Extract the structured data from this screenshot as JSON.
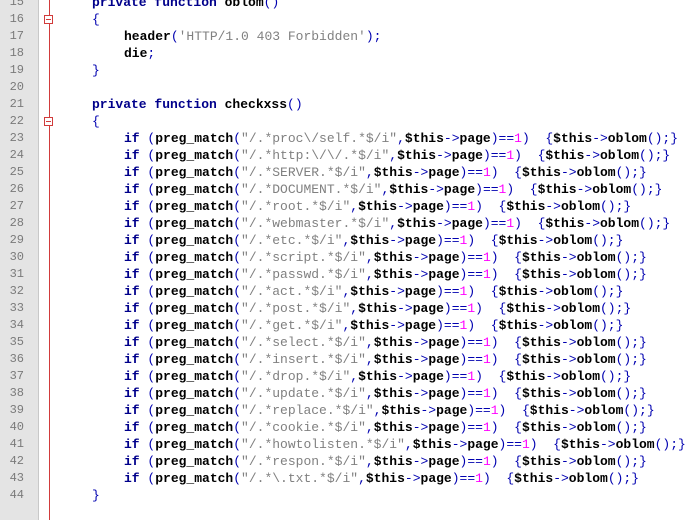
{
  "lines": [
    {
      "n": "15",
      "ind": 1,
      "t": [
        [
          "kw",
          "private function "
        ],
        [
          "fn",
          "oblom"
        ],
        [
          "br",
          "()"
        ]
      ]
    },
    {
      "n": "16",
      "ind": 1,
      "t": [
        [
          "br",
          "{"
        ]
      ],
      "fold": true
    },
    {
      "n": "17",
      "ind": 2,
      "t": [
        [
          "fn",
          "header"
        ],
        [
          "br",
          "("
        ],
        [
          "str",
          "'HTTP/1.0 403 Forbidden'"
        ],
        [
          "br",
          ");"
        ]
      ]
    },
    {
      "n": "18",
      "ind": 2,
      "t": [
        [
          "fn",
          "die"
        ],
        [
          "br",
          ";"
        ]
      ]
    },
    {
      "n": "19",
      "ind": 1,
      "t": [
        [
          "br",
          "}"
        ]
      ]
    },
    {
      "n": "20",
      "ind": 0,
      "t": []
    },
    {
      "n": "21",
      "ind": 1,
      "t": [
        [
          "kw",
          "private function "
        ],
        [
          "fn",
          "checkxss"
        ],
        [
          "br",
          "()"
        ]
      ]
    },
    {
      "n": "22",
      "ind": 1,
      "t": [
        [
          "br",
          "{"
        ]
      ],
      "fold": true
    },
    {
      "n": "23",
      "ind": 2,
      "pm": "\"/.*proc\\/self.*$/i\""
    },
    {
      "n": "24",
      "ind": 2,
      "pm": "\"/.*http:\\/\\/.*$/i\""
    },
    {
      "n": "25",
      "ind": 2,
      "pm": "\"/.*SERVER.*$/i\""
    },
    {
      "n": "26",
      "ind": 2,
      "pm": "\"/.*DOCUMENT.*$/i\""
    },
    {
      "n": "27",
      "ind": 2,
      "pm": "\"/.*root.*$/i\""
    },
    {
      "n": "28",
      "ind": 2,
      "pm": "\"/.*webmaster.*$/i\""
    },
    {
      "n": "29",
      "ind": 2,
      "pm": "\"/.*etc.*$/i\""
    },
    {
      "n": "30",
      "ind": 2,
      "pm": "\"/.*script.*$/i\""
    },
    {
      "n": "31",
      "ind": 2,
      "pm": "\"/.*passwd.*$/i\""
    },
    {
      "n": "32",
      "ind": 2,
      "pm": "\"/.*act.*$/i\""
    },
    {
      "n": "33",
      "ind": 2,
      "pm": "\"/.*post.*$/i\""
    },
    {
      "n": "34",
      "ind": 2,
      "pm": "\"/.*get.*$/i\""
    },
    {
      "n": "35",
      "ind": 2,
      "pm": "\"/.*select.*$/i\""
    },
    {
      "n": "36",
      "ind": 2,
      "pm": "\"/.*insert.*$/i\""
    },
    {
      "n": "37",
      "ind": 2,
      "pm": "\"/.*drop.*$/i\""
    },
    {
      "n": "38",
      "ind": 2,
      "pm": "\"/.*update.*$/i\""
    },
    {
      "n": "39",
      "ind": 2,
      "pm": "\"/.*replace.*$/i\""
    },
    {
      "n": "40",
      "ind": 2,
      "pm": "\"/.*cookie.*$/i\""
    },
    {
      "n": "41",
      "ind": 2,
      "pm": "\"/.*howtolisten.*$/i\""
    },
    {
      "n": "42",
      "ind": 2,
      "pm": "\"/.*respon.*$/i\""
    },
    {
      "n": "43",
      "ind": 2,
      "pm": "\"/.*\\.txt.*$/i\""
    },
    {
      "n": "44",
      "ind": 1,
      "t": [
        [
          "br",
          "}"
        ]
      ]
    }
  ],
  "pm_parts": {
    "if_kw": "if ",
    "open": "(",
    "fn": "preg_match",
    "open2": "(",
    "comma": ",",
    "var": "$this",
    "arrow": "->",
    "prop": "page",
    "close_eq": ")==",
    "one": "1",
    "close": ") ",
    "block_open": "{",
    "call_var": "$this",
    "call_arrow": "->",
    "call_fn": "oblom",
    "call_tail": "();",
    "block_close": "}"
  }
}
